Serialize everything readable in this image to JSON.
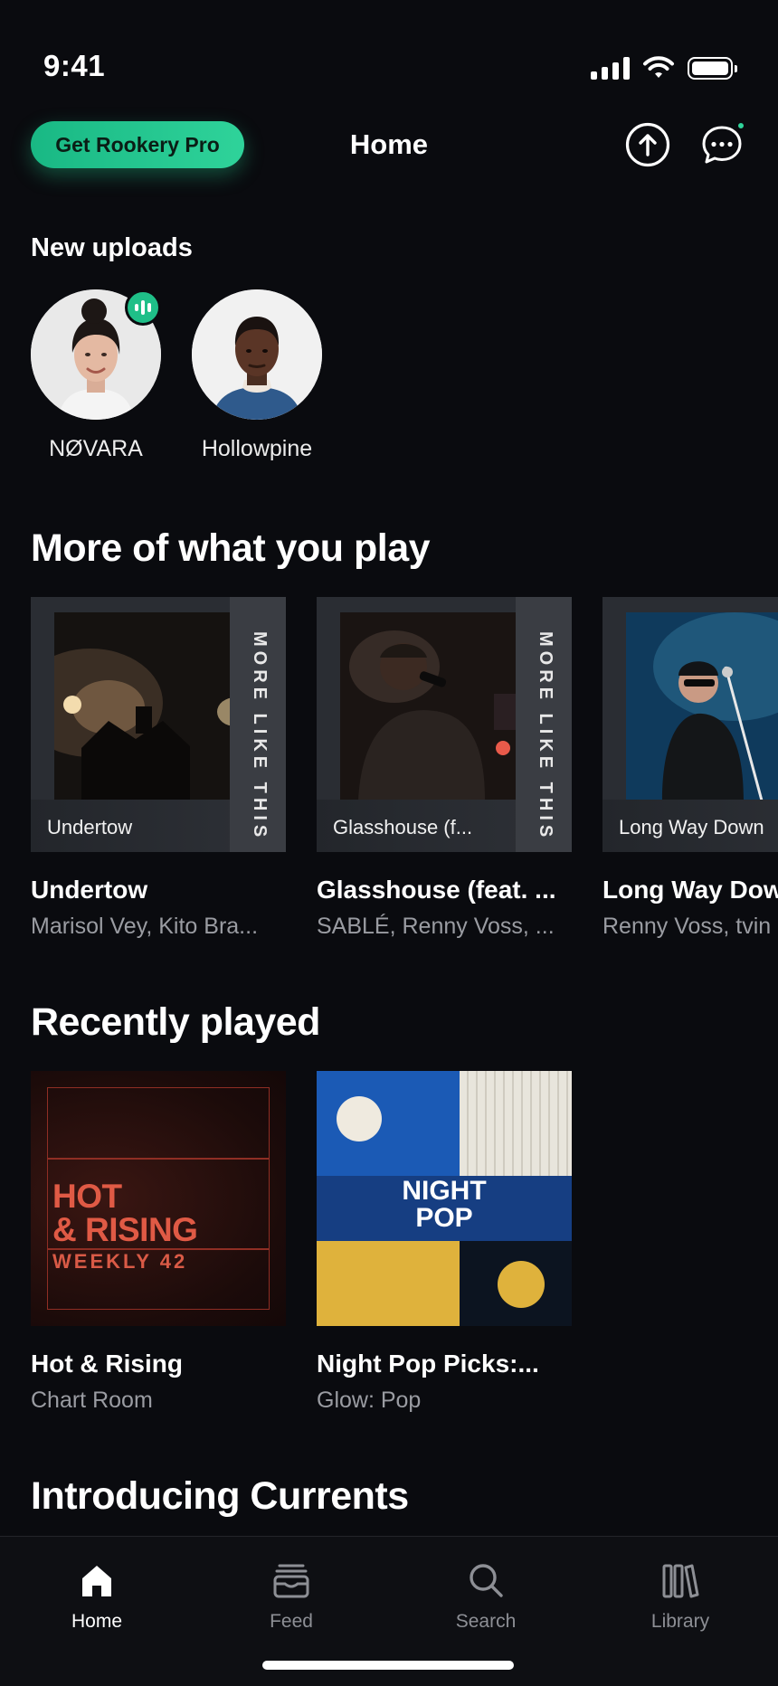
{
  "status_bar": {
    "time": "9:41"
  },
  "header": {
    "pro_button": "Get Rookery Pro",
    "title": "Home"
  },
  "new_uploads": {
    "title": "New uploads",
    "artists": [
      {
        "name": "NØVARA",
        "live": true
      },
      {
        "name": "Hollowpine",
        "live": false
      }
    ]
  },
  "more_of_what_you_play": {
    "title": "More of what you play",
    "strip_label": "MORE LIKE THIS",
    "cards": [
      {
        "label": "Undertow",
        "title": "Undertow",
        "subtitle": "Marisol Vey, Kito Bra..."
      },
      {
        "label": "Glasshouse (f...",
        "title": "Glasshouse (feat. ...",
        "subtitle": "SABLÉ, Renny Voss, ..."
      },
      {
        "label": "Long Way Down",
        "title": "Long Way Down",
        "subtitle": "Renny Voss, tvin"
      }
    ]
  },
  "recently_played": {
    "title": "Recently played",
    "items": [
      {
        "title": "Hot & Rising",
        "subtitle": "Chart Room",
        "art_line1": "HOT",
        "art_line2": "& RISING",
        "art_line3": "WEEKLY 42"
      },
      {
        "title": "Night Pop Picks:...",
        "subtitle": "Glow: Pop",
        "art_line1": "NIGHT",
        "art_line2": "POP"
      }
    ]
  },
  "introducing": {
    "title": "Introducing Currents"
  },
  "bottom_nav": {
    "items": [
      {
        "label": "Home",
        "icon": "home-icon",
        "active": true
      },
      {
        "label": "Feed",
        "icon": "feed-icon",
        "active": false
      },
      {
        "label": "Search",
        "icon": "search-icon",
        "active": false
      },
      {
        "label": "Library",
        "icon": "library-icon",
        "active": false
      }
    ]
  },
  "colors": {
    "accent": "#2fd39a",
    "background": "#0a0b0f"
  }
}
